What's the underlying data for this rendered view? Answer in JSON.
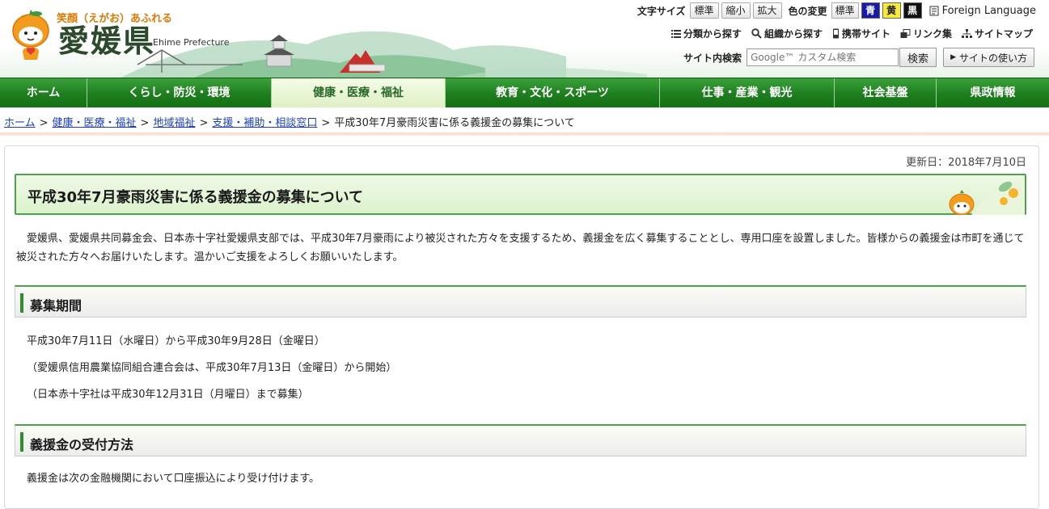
{
  "header": {
    "tagline": "笑顔（えがお）あふれる",
    "site_name": "愛媛県",
    "site_name_en": "Ehime Prefecture",
    "font_size_label": "文字サイズ",
    "font_size_buttons": [
      "標準",
      "縮小",
      "拡大"
    ],
    "color_label": "色の変更",
    "color_buttons": {
      "standard": "標準",
      "blue": "青",
      "yellow": "黄",
      "black": "黒"
    },
    "foreign_language": "Foreign Language",
    "links": [
      "分類から探す",
      "組織から探す",
      "携帯サイト",
      "リンク集",
      "サイトマップ"
    ],
    "search_label": "サイト内検索",
    "search_placeholder": "Google™ カスタム検索",
    "search_button": "検索",
    "howto_button": "サイトの使い方"
  },
  "nav": {
    "items": [
      "ホーム",
      "くらし・防災・環境",
      "健康・医療・福祉",
      "教育・文化・スポーツ",
      "仕事・産業・観光",
      "社会基盤",
      "県政情報"
    ],
    "active_index": 2
  },
  "breadcrumb": {
    "links": [
      "ホーム",
      "健康・医療・福祉",
      "地域福祉",
      "支援・補助・相談窓口"
    ],
    "current": "平成30年7月豪雨災害に係る義援金の募集について"
  },
  "page": {
    "updated": "更新日：2018年7月10日",
    "title": "平成30年7月豪雨災害に係る義援金の募集について",
    "lead": "愛媛県、愛媛県共同募金会、日本赤十字社愛媛県支部では、平成30年7月豪雨により被災された方々を支援するため、義援金を広く募集することとし、専用口座を設置しました。皆様からの義援金は市町を通じて被災された方々へお届けいたします。温かいご支援をよろしくお願いいたします。",
    "sections": [
      {
        "heading": "募集期間",
        "paragraphs": [
          "平成30年7月11日（水曜日）から平成30年9月28日（金曜日）",
          "（愛媛県信用農業協同組合連合会は、平成30年7月13日（金曜日）から開始）",
          "（日本赤十字社は平成30年12月31日（月曜日）まで募集）"
        ]
      },
      {
        "heading": "義援金の受付方法",
        "paragraphs": [
          "義援金は次の金融機関において口座振込により受け付けます。"
        ]
      }
    ]
  },
  "colors": {
    "nav_green": "#1f7a1f",
    "accent_green": "#4aa54a",
    "link_blue": "#1a3fbf",
    "tagline_orange": "#e07800"
  }
}
